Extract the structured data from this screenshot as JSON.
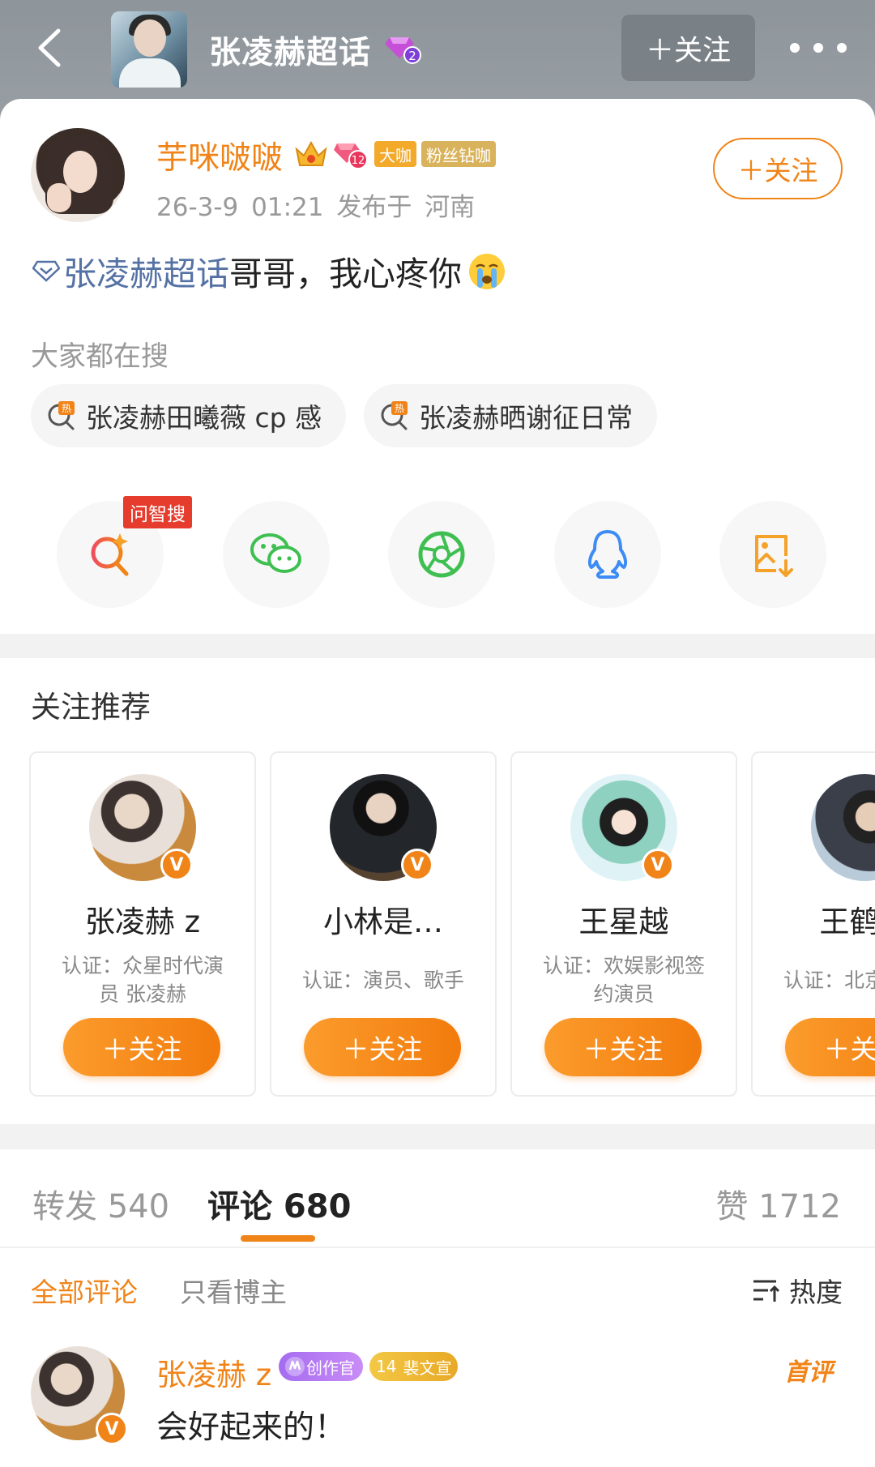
{
  "header": {
    "topic_title": "张凌赫超话",
    "topic_level": "2",
    "follow_label": "＋关注",
    "more_icon": "more-dots-icon"
  },
  "post": {
    "author": "芋咪啵啵",
    "level_badge": "12",
    "tag_daka": "大咖",
    "tag_fans": "粉丝钻咖",
    "timestamp": "26-3-9 01:21",
    "location": "发布于 河南",
    "follow_label": "＋关注",
    "topic_link": "张凌赫超话",
    "text": " 哥哥，我心疼你",
    "search_label": "大家都在搜",
    "hot_searches": [
      "张凌赫田曦薇 cp 感",
      "张凌赫晒谢征日常"
    ],
    "share_tag": "问智搜"
  },
  "recommend": {
    "title": "关注推荐",
    "cards": [
      {
        "name": "张凌赫 z",
        "desc": "认证：众星时代演员 张凌赫",
        "follow": "＋关注",
        "verified": "V"
      },
      {
        "name": "小林是…",
        "desc": "认证：演员、歌手",
        "follow": "＋关注",
        "verified": "V"
      },
      {
        "name": "王星越",
        "desc": "认证：欢娱影视签约演员",
        "follow": "＋关注",
        "verified": "V"
      },
      {
        "name": "王鹤棣",
        "desc": "认证：北京视签约",
        "follow": "＋关注",
        "verified": "V"
      }
    ]
  },
  "tabs": {
    "repost": "转发 540",
    "comment": "评论 680",
    "like": "赞 1712"
  },
  "filters": {
    "all": "全部评论",
    "op_only": "只看博主",
    "sort": "热度"
  },
  "comment": {
    "author": "张凌赫 z",
    "tag_creator": "创作官",
    "tag_level": "14",
    "tag_wen": "裴文宣",
    "first_label": "首评",
    "text": "会好起来的！",
    "verified": "V"
  },
  "colors": {
    "accent": "#f08418",
    "topic_blue": "#5572a4",
    "creator_purple": "#a56cf0"
  }
}
